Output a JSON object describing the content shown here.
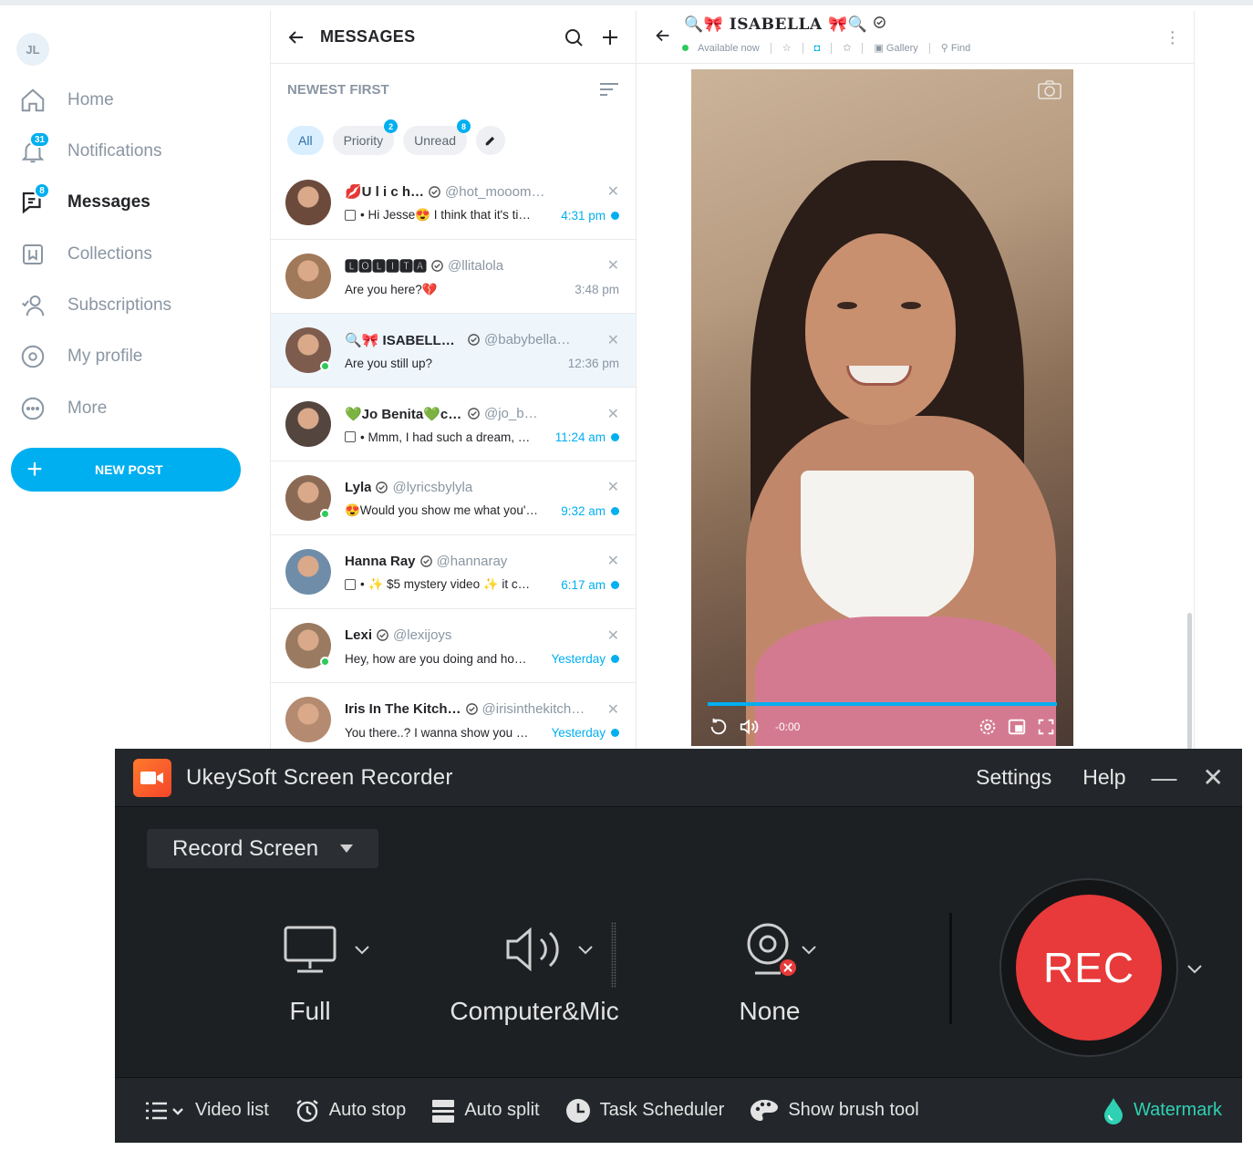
{
  "sidebar": {
    "avatar_initials": "JL",
    "items": [
      {
        "label": "Home",
        "icon": "home-icon"
      },
      {
        "label": "Notifications",
        "icon": "bell-icon",
        "badge": "31"
      },
      {
        "label": "Messages",
        "icon": "chat-icon",
        "badge": "8"
      },
      {
        "label": "Collections",
        "icon": "bookmark-icon"
      },
      {
        "label": "Subscriptions",
        "icon": "users-icon"
      },
      {
        "label": "My profile",
        "icon": "profile-icon"
      },
      {
        "label": "More",
        "icon": "more-icon"
      }
    ],
    "new_post_label": "NEW POST"
  },
  "messages": {
    "title": "MESSAGES",
    "sort_label": "NEWEST FIRST",
    "filters": [
      {
        "label": "All"
      },
      {
        "label": "Priority",
        "count": "2"
      },
      {
        "label": "Unread",
        "count": "8"
      }
    ],
    "conversations": [
      {
        "name": "💋U l i c h…",
        "handle": "@hot_mooom…",
        "preview": "• Hi Jesse😍 I think that it's ti…",
        "time": "4:31 pm",
        "unread": true,
        "media": true,
        "online": false
      },
      {
        "name": "🅻🅾🅻🅸🆃🅰",
        "handle": "@llitalola",
        "preview": "Are you here?💔",
        "time": "3:48 pm",
        "unread": false,
        "media": false,
        "online": false
      },
      {
        "name": "🔍🎀 ISABELLA …",
        "handle": "@babybella…",
        "preview": "Are you still up?",
        "time": "12:36 pm",
        "unread": false,
        "media": false,
        "online": true
      },
      {
        "name": "💚Jo Benita💚check …",
        "handle": "@jo_b…",
        "preview": "• Mmm, I had such a dream, …",
        "time": "11:24 am",
        "unread": true,
        "media": true,
        "online": false
      },
      {
        "name": "Lyla",
        "handle": "@lyricsbylyla",
        "preview": "😍Would you show me what you'…",
        "time": "9:32 am",
        "unread": true,
        "media": false,
        "online": true
      },
      {
        "name": "Hanna Ray",
        "handle": "@hannaray",
        "preview": "• ✨ $5 mystery video ✨ it c…",
        "time": "6:17 am",
        "unread": true,
        "media": true,
        "online": false
      },
      {
        "name": "Lexi",
        "handle": "@lexijoys",
        "preview": "Hey, how are you doing and ho…",
        "time": "Yesterday",
        "unread": true,
        "media": false,
        "online": true
      },
      {
        "name": "Iris In The Kitch…",
        "handle": "@irisinthekitch…",
        "preview": "You there..? I wanna show you …",
        "time": "Yesterday",
        "unread": true,
        "media": false,
        "online": false
      }
    ]
  },
  "chat": {
    "name": "🔍🎀 ISABELLA 🎀🔍",
    "status": "Available now",
    "gallery_label": "Gallery",
    "find_label": "Find",
    "video_time": "-0:00"
  },
  "recorder": {
    "app_title": "UkeySoft Screen Recorder",
    "settings_label": "Settings",
    "help_label": "Help",
    "mode": "Record Screen",
    "sources": [
      {
        "label": "Full",
        "icon": "monitor-icon"
      },
      {
        "label": "Computer&Mic",
        "icon": "speaker-icon"
      },
      {
        "label": "None",
        "icon": "webcam-icon"
      }
    ],
    "rec_label": "REC",
    "tools": [
      {
        "label": "Video list",
        "icon": "list-icon"
      },
      {
        "label": "Auto stop",
        "icon": "alarm-icon"
      },
      {
        "label": "Auto split",
        "icon": "split-icon"
      },
      {
        "label": "Task Scheduler",
        "icon": "clock-icon"
      },
      {
        "label": "Show brush tool",
        "icon": "palette-icon"
      }
    ],
    "watermark_label": "Watermark"
  },
  "colors": {
    "accent": "#00aff0",
    "rec_red": "#e83a3a",
    "watermark": "#2fd1b4",
    "recorder_bg": "#1d2023"
  }
}
